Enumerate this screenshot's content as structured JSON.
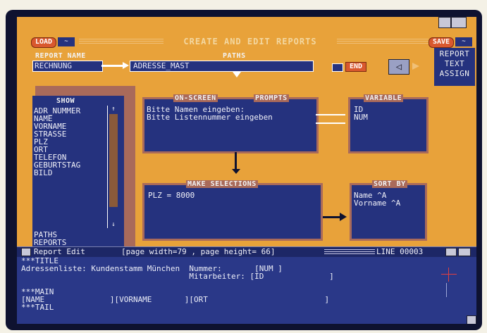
{
  "header": {
    "load_label": "LOAD",
    "load_arrow": "~",
    "title": "CREATE AND EDIT REPORTS",
    "save_label": "SAVE",
    "save_arrow": "~"
  },
  "report_name": {
    "label": "REPORT NAME",
    "value": "RECHNUNG"
  },
  "paths": {
    "label": "PATHS",
    "value": "ADRESSE_MAST",
    "end_label": "END"
  },
  "report_menu": [
    "REPORT",
    "TEXT",
    "ASSIGN"
  ],
  "show": {
    "label": "SHOW",
    "items": [
      "ADR_NUMMER",
      "NAME",
      "VORNAME",
      "STRASSE",
      "PLZ",
      "ORT",
      "TELEFON",
      "GEBURTSTAG",
      "BILD"
    ],
    "bottom_items": [
      "PATHS",
      "REPORTS"
    ]
  },
  "prompts": {
    "label_left": "ON-SCREEN",
    "label_right": "PROMPTS",
    "lines": [
      "Bitte Namen eingeben:",
      "Bitte Listennummer eingeben"
    ]
  },
  "variable": {
    "label": "VARIABLE",
    "lines": [
      "ID",
      "NUM"
    ]
  },
  "selections": {
    "label": "MAKE SELECTIONS",
    "lines": [
      "PLZ = 8000"
    ]
  },
  "sort": {
    "label": "SORT BY",
    "lines": [
      "Name ^A",
      "Vorname ^A"
    ]
  },
  "status": {
    "mode": "Report Edit",
    "page_info": "[page width=79 , page height= 66]",
    "line_info": "LINE 00003"
  },
  "editor": {
    "lines": [
      "***TITLE",
      "Adressenliste: Kundenstamm München  Nummer:       [NUM ]",
      "                                    Mitarbeiter: [ID              ]",
      "",
      "***MAIN",
      "[NAME              ][VORNAME       ][ORT                         ]",
      "***TAIL"
    ]
  },
  "colors": {
    "background": "#e8a23a",
    "panel": "#25327e",
    "frame": "#a96a5a",
    "button": "#d9582e",
    "bezel": "#0e1230"
  }
}
